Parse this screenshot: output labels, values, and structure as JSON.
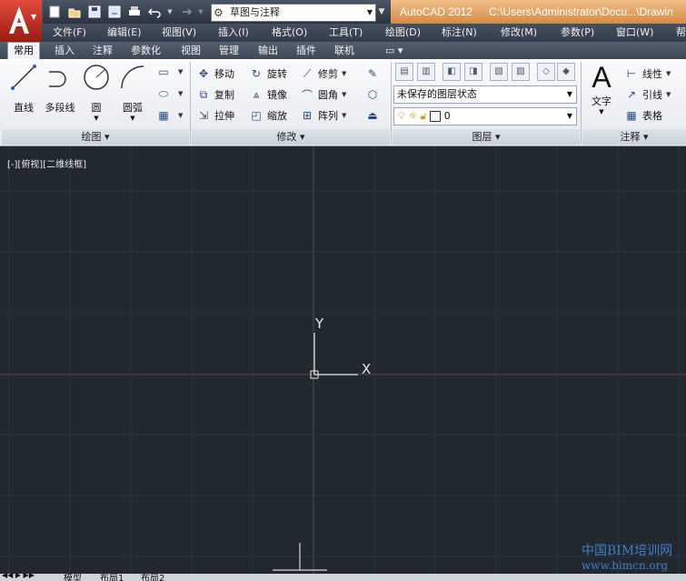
{
  "title_bar": {
    "workspace": "草图与注释",
    "app_name": "AutoCAD 2012",
    "file_path": "C:\\Users\\Administrator\\Docu...\\Drawin"
  },
  "menu": [
    "文件(F)",
    "编辑(E)",
    "视图(V)",
    "插入(I)",
    "格式(O)",
    "工具(T)",
    "绘图(D)",
    "标注(N)",
    "修改(M)",
    "参数(P)",
    "窗口(W)",
    "帮"
  ],
  "tabs": [
    "常用",
    "插入",
    "注释",
    "参数化",
    "视图",
    "管理",
    "输出",
    "插件",
    "联机"
  ],
  "ribbon": {
    "draw": {
      "title": "绘图",
      "tools": [
        "直线",
        "多段线",
        "圆",
        "圆弧"
      ]
    },
    "modify": {
      "title": "修改",
      "rows": [
        [
          "移动",
          "旋转",
          "修剪"
        ],
        [
          "复制",
          "镜像",
          "圆角"
        ],
        [
          "拉伸",
          "缩放",
          "阵列"
        ]
      ]
    },
    "layers": {
      "title": "图层",
      "state": "未保存的图层状态",
      "current_layer": "0"
    },
    "annotation": {
      "title": "注释",
      "text_tool": "文字",
      "items": [
        "线性",
        "引线",
        "表格"
      ]
    }
  },
  "canvas": {
    "viewport_label": "[-][俯视][二维线框]",
    "ucs_x": "X",
    "ucs_y": "Y"
  },
  "layout_tabs": [
    "模型",
    "布局1",
    "布局2"
  ],
  "watermark": {
    "line1": "中国BIM培训网",
    "line2": "www.bimcn.org"
  }
}
